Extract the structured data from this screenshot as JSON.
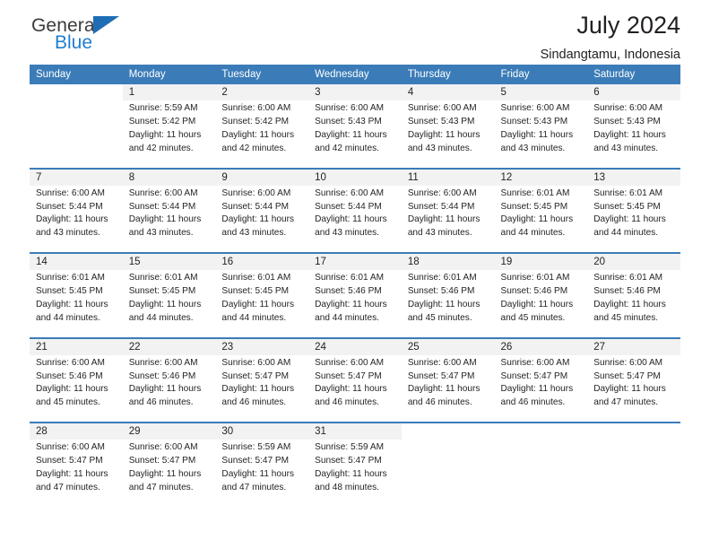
{
  "brand": {
    "name_dark": "General",
    "name_blue": "Blue",
    "accent_blue": "#1f7fd0",
    "header_blue": "#3b7cb8"
  },
  "header": {
    "title": "July 2024",
    "subtitle": "Sindangtamu, Indonesia"
  },
  "calendar": {
    "weekday_headers": [
      "Sunday",
      "Monday",
      "Tuesday",
      "Wednesday",
      "Thursday",
      "Friday",
      "Saturday"
    ],
    "weeks": [
      [
        {
          "day": "",
          "sunrise": "",
          "sunset": "",
          "daylight_line1": "",
          "daylight_line2": ""
        },
        {
          "day": "1",
          "sunrise": "Sunrise: 5:59 AM",
          "sunset": "Sunset: 5:42 PM",
          "daylight_line1": "Daylight: 11 hours",
          "daylight_line2": "and 42 minutes."
        },
        {
          "day": "2",
          "sunrise": "Sunrise: 6:00 AM",
          "sunset": "Sunset: 5:42 PM",
          "daylight_line1": "Daylight: 11 hours",
          "daylight_line2": "and 42 minutes."
        },
        {
          "day": "3",
          "sunrise": "Sunrise: 6:00 AM",
          "sunset": "Sunset: 5:43 PM",
          "daylight_line1": "Daylight: 11 hours",
          "daylight_line2": "and 42 minutes."
        },
        {
          "day": "4",
          "sunrise": "Sunrise: 6:00 AM",
          "sunset": "Sunset: 5:43 PM",
          "daylight_line1": "Daylight: 11 hours",
          "daylight_line2": "and 43 minutes."
        },
        {
          "day": "5",
          "sunrise": "Sunrise: 6:00 AM",
          "sunset": "Sunset: 5:43 PM",
          "daylight_line1": "Daylight: 11 hours",
          "daylight_line2": "and 43 minutes."
        },
        {
          "day": "6",
          "sunrise": "Sunrise: 6:00 AM",
          "sunset": "Sunset: 5:43 PM",
          "daylight_line1": "Daylight: 11 hours",
          "daylight_line2": "and 43 minutes."
        }
      ],
      [
        {
          "day": "7",
          "sunrise": "Sunrise: 6:00 AM",
          "sunset": "Sunset: 5:44 PM",
          "daylight_line1": "Daylight: 11 hours",
          "daylight_line2": "and 43 minutes."
        },
        {
          "day": "8",
          "sunrise": "Sunrise: 6:00 AM",
          "sunset": "Sunset: 5:44 PM",
          "daylight_line1": "Daylight: 11 hours",
          "daylight_line2": "and 43 minutes."
        },
        {
          "day": "9",
          "sunrise": "Sunrise: 6:00 AM",
          "sunset": "Sunset: 5:44 PM",
          "daylight_line1": "Daylight: 11 hours",
          "daylight_line2": "and 43 minutes."
        },
        {
          "day": "10",
          "sunrise": "Sunrise: 6:00 AM",
          "sunset": "Sunset: 5:44 PM",
          "daylight_line1": "Daylight: 11 hours",
          "daylight_line2": "and 43 minutes."
        },
        {
          "day": "11",
          "sunrise": "Sunrise: 6:00 AM",
          "sunset": "Sunset: 5:44 PM",
          "daylight_line1": "Daylight: 11 hours",
          "daylight_line2": "and 43 minutes."
        },
        {
          "day": "12",
          "sunrise": "Sunrise: 6:01 AM",
          "sunset": "Sunset: 5:45 PM",
          "daylight_line1": "Daylight: 11 hours",
          "daylight_line2": "and 44 minutes."
        },
        {
          "day": "13",
          "sunrise": "Sunrise: 6:01 AM",
          "sunset": "Sunset: 5:45 PM",
          "daylight_line1": "Daylight: 11 hours",
          "daylight_line2": "and 44 minutes."
        }
      ],
      [
        {
          "day": "14",
          "sunrise": "Sunrise: 6:01 AM",
          "sunset": "Sunset: 5:45 PM",
          "daylight_line1": "Daylight: 11 hours",
          "daylight_line2": "and 44 minutes."
        },
        {
          "day": "15",
          "sunrise": "Sunrise: 6:01 AM",
          "sunset": "Sunset: 5:45 PM",
          "daylight_line1": "Daylight: 11 hours",
          "daylight_line2": "and 44 minutes."
        },
        {
          "day": "16",
          "sunrise": "Sunrise: 6:01 AM",
          "sunset": "Sunset: 5:45 PM",
          "daylight_line1": "Daylight: 11 hours",
          "daylight_line2": "and 44 minutes."
        },
        {
          "day": "17",
          "sunrise": "Sunrise: 6:01 AM",
          "sunset": "Sunset: 5:46 PM",
          "daylight_line1": "Daylight: 11 hours",
          "daylight_line2": "and 44 minutes."
        },
        {
          "day": "18",
          "sunrise": "Sunrise: 6:01 AM",
          "sunset": "Sunset: 5:46 PM",
          "daylight_line1": "Daylight: 11 hours",
          "daylight_line2": "and 45 minutes."
        },
        {
          "day": "19",
          "sunrise": "Sunrise: 6:01 AM",
          "sunset": "Sunset: 5:46 PM",
          "daylight_line1": "Daylight: 11 hours",
          "daylight_line2": "and 45 minutes."
        },
        {
          "day": "20",
          "sunrise": "Sunrise: 6:01 AM",
          "sunset": "Sunset: 5:46 PM",
          "daylight_line1": "Daylight: 11 hours",
          "daylight_line2": "and 45 minutes."
        }
      ],
      [
        {
          "day": "21",
          "sunrise": "Sunrise: 6:00 AM",
          "sunset": "Sunset: 5:46 PM",
          "daylight_line1": "Daylight: 11 hours",
          "daylight_line2": "and 45 minutes."
        },
        {
          "day": "22",
          "sunrise": "Sunrise: 6:00 AM",
          "sunset": "Sunset: 5:46 PM",
          "daylight_line1": "Daylight: 11 hours",
          "daylight_line2": "and 46 minutes."
        },
        {
          "day": "23",
          "sunrise": "Sunrise: 6:00 AM",
          "sunset": "Sunset: 5:47 PM",
          "daylight_line1": "Daylight: 11 hours",
          "daylight_line2": "and 46 minutes."
        },
        {
          "day": "24",
          "sunrise": "Sunrise: 6:00 AM",
          "sunset": "Sunset: 5:47 PM",
          "daylight_line1": "Daylight: 11 hours",
          "daylight_line2": "and 46 minutes."
        },
        {
          "day": "25",
          "sunrise": "Sunrise: 6:00 AM",
          "sunset": "Sunset: 5:47 PM",
          "daylight_line1": "Daylight: 11 hours",
          "daylight_line2": "and 46 minutes."
        },
        {
          "day": "26",
          "sunrise": "Sunrise: 6:00 AM",
          "sunset": "Sunset: 5:47 PM",
          "daylight_line1": "Daylight: 11 hours",
          "daylight_line2": "and 46 minutes."
        },
        {
          "day": "27",
          "sunrise": "Sunrise: 6:00 AM",
          "sunset": "Sunset: 5:47 PM",
          "daylight_line1": "Daylight: 11 hours",
          "daylight_line2": "and 47 minutes."
        }
      ],
      [
        {
          "day": "28",
          "sunrise": "Sunrise: 6:00 AM",
          "sunset": "Sunset: 5:47 PM",
          "daylight_line1": "Daylight: 11 hours",
          "daylight_line2": "and 47 minutes."
        },
        {
          "day": "29",
          "sunrise": "Sunrise: 6:00 AM",
          "sunset": "Sunset: 5:47 PM",
          "daylight_line1": "Daylight: 11 hours",
          "daylight_line2": "and 47 minutes."
        },
        {
          "day": "30",
          "sunrise": "Sunrise: 5:59 AM",
          "sunset": "Sunset: 5:47 PM",
          "daylight_line1": "Daylight: 11 hours",
          "daylight_line2": "and 47 minutes."
        },
        {
          "day": "31",
          "sunrise": "Sunrise: 5:59 AM",
          "sunset": "Sunset: 5:47 PM",
          "daylight_line1": "Daylight: 11 hours",
          "daylight_line2": "and 48 minutes."
        },
        {
          "day": "",
          "sunrise": "",
          "sunset": "",
          "daylight_line1": "",
          "daylight_line2": ""
        },
        {
          "day": "",
          "sunrise": "",
          "sunset": "",
          "daylight_line1": "",
          "daylight_line2": ""
        },
        {
          "day": "",
          "sunrise": "",
          "sunset": "",
          "daylight_line1": "",
          "daylight_line2": ""
        }
      ]
    ]
  }
}
